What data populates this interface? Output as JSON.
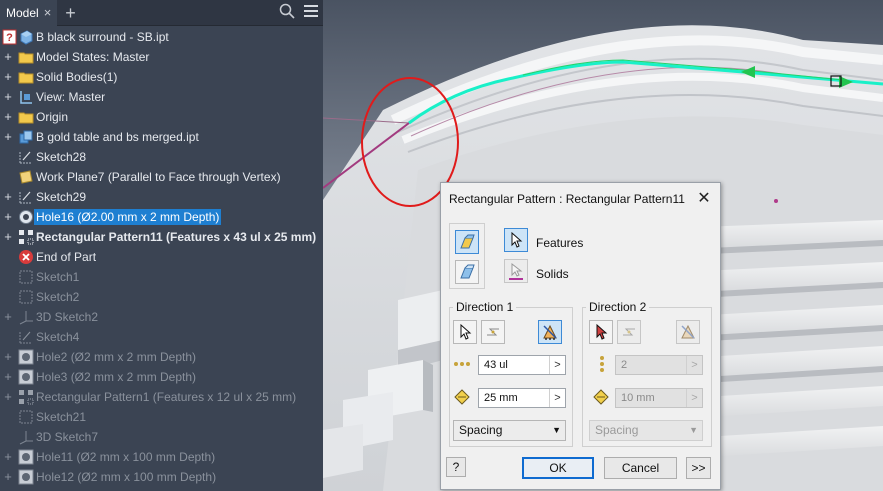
{
  "browser": {
    "tab_label": "Model",
    "tab_close": "×",
    "add_tab": "+",
    "items": [
      {
        "label": "B black surround - SB.ipt",
        "icon": "part-icon"
      },
      {
        "label": "Model States: Master",
        "icon": "folder-icon"
      },
      {
        "label": "Solid Bodies(1)",
        "icon": "folder-icon"
      },
      {
        "label": "View: Master",
        "icon": "view-icon"
      },
      {
        "label": "Origin",
        "icon": "folder-icon"
      },
      {
        "label": "B gold table and bs merged.ipt",
        "icon": "derived-part-icon"
      },
      {
        "label": "Sketch28",
        "icon": "sketch-icon"
      },
      {
        "label": "Work Plane7 (Parallel to Face through Vertex)",
        "icon": "work-plane-icon"
      },
      {
        "label": "Sketch29",
        "icon": "sketch-icon"
      },
      {
        "label": "Hole16 (Ø2.00 mm x 2 mm Depth)",
        "icon": "hole-icon"
      },
      {
        "label": "Rectangular Pattern11 (Features x 43 ul x 25 mm)",
        "icon": "rectangular-pattern-icon"
      },
      {
        "label": "End of Part",
        "icon": "end-of-part-icon"
      },
      {
        "label": "Sketch1",
        "icon": "sketch-icon"
      },
      {
        "label": "Sketch2",
        "icon": "sketch-icon"
      },
      {
        "label": "3D Sketch2",
        "icon": "3d-sketch-icon"
      },
      {
        "label": "Sketch4",
        "icon": "sketch-icon"
      },
      {
        "label": "Hole2 (Ø2 mm x 2 mm Depth)",
        "icon": "hole-icon"
      },
      {
        "label": "Hole3 (Ø2 mm x 2 mm Depth)",
        "icon": "hole-icon"
      },
      {
        "label": "Rectangular Pattern1 (Features x 12 ul x 25 mm)",
        "icon": "rectangular-pattern-icon"
      },
      {
        "label": "Sketch21",
        "icon": "sketch-icon"
      },
      {
        "label": "3D Sketch7",
        "icon": "3d-sketch-icon"
      },
      {
        "label": "Hole11 (Ø2 mm x 100 mm Depth)",
        "icon": "hole-icon"
      },
      {
        "label": "Hole12 (Ø2 mm x 100 mm Depth)",
        "icon": "hole-icon"
      }
    ]
  },
  "dialog": {
    "title": "Rectangular Pattern : Rectangular Pattern11",
    "close": "✕",
    "features_label": "Features",
    "solids_label": "Solids",
    "direction1": {
      "label": "Direction 1",
      "count": "43 ul",
      "spacing": "25 mm",
      "spacing_type": "Spacing"
    },
    "direction2": {
      "label": "Direction 2",
      "count": "2",
      "spacing": "10 mm",
      "spacing_type": "Spacing"
    },
    "help": "?",
    "ok": "OK",
    "cancel": "Cancel",
    "more": ">>"
  },
  "colors": {
    "browser_bg": "#3b4453",
    "selection": "#1e7fd1",
    "highlight_path": "#19f0c8",
    "annotation_circle": "#e01b1b"
  }
}
